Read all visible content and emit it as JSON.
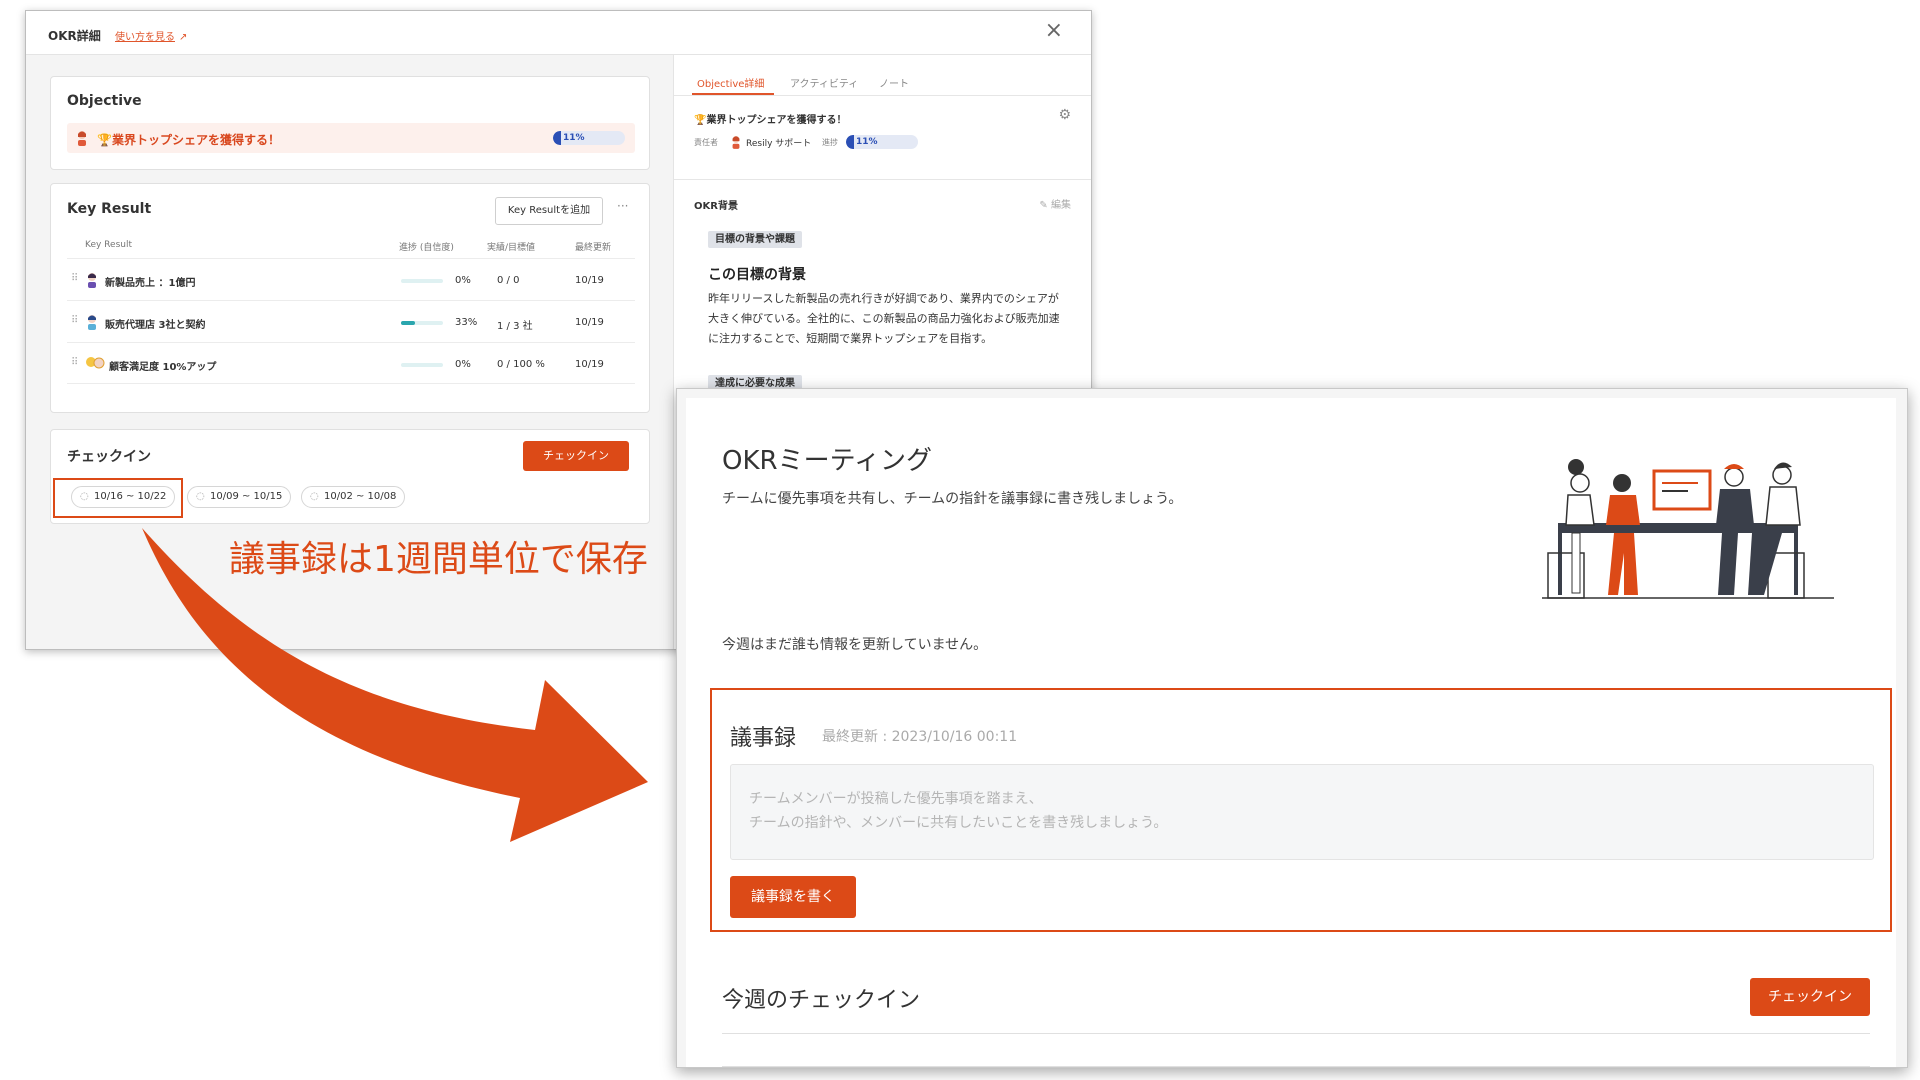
{
  "okr": {
    "title": "OKR詳細",
    "howto_link": "使い方を見る",
    "objective": {
      "heading": "Objective",
      "text": "🏆業界トップシェアを獲得する！",
      "progress": 11,
      "progress_label": "11%"
    },
    "key_result": {
      "heading": "Key Result",
      "add_button": "Key Resultを追加",
      "more": "···",
      "columns": [
        "Key Result",
        "進捗 (自信度)",
        "実績/目標値",
        "最終更新"
      ],
      "rows": [
        {
          "name": "新製品売上 ：1億円",
          "progress": 0,
          "pct": "0%",
          "actual": "0 / 0",
          "updated": "10/19"
        },
        {
          "name": "販売代理店 3社と契約",
          "progress": 33,
          "pct": "33%",
          "actual": "1 / 3 社",
          "updated": "10/19"
        },
        {
          "name": "顧客満足度 10%アップ",
          "progress": 0,
          "pct": "0%",
          "actual": "0 / 100 %",
          "updated": "10/19"
        }
      ]
    },
    "checkin": {
      "heading": "チェックイン",
      "button": "チェックイン",
      "weeks": [
        "10/16 ~ 10/22",
        "10/09 ~ 10/15",
        "10/02 ~ 10/08"
      ]
    },
    "right_pane": {
      "tabs": [
        "Objective詳細",
        "アクティビティ",
        "ノート"
      ],
      "objective_title": "🏆業界トップシェアを獲得する！",
      "owner_label": "責任者",
      "owner_name": "Resily サポート",
      "progress_label": "進捗",
      "progress": 11,
      "progress_text": "11%",
      "background_heading": "OKR背景",
      "edit_label": "編集",
      "tag1": "目標の背景や課題",
      "section_title": "この目標の背景",
      "section_body": "昨年リリースした新製品の売れ行きが好調であり、業界内でのシェアが大きく伸びている。全社的に、この新製品の商品力強化および販売加速に注力することで、短期間で業界トップシェアを目指す。",
      "tag2": "達成に必要な成果"
    }
  },
  "meeting": {
    "title": "OKRミーティング",
    "subtitle": "チームに優先事項を共有し、チームの指針を議事録に書き残しましょう。",
    "no_update": "今週はまだ誰も情報を更新していません。",
    "minutes": {
      "heading": "議事録",
      "last_updated": "最終更新 : 2023/10/16 00:11",
      "placeholder": "チームメンバーが投稿した優先事項を踏まえ、\nチームの指針や、メンバーに共有したいことを書き残しましょう。",
      "button": "議事録を書く"
    },
    "week_checkin": {
      "heading": "今週のチェックイン",
      "button": "チェックイン"
    }
  },
  "annotation": {
    "text": "議事録は1週間単位で保存"
  },
  "colors": {
    "accent": "#dc4a17",
    "progress_blue": "#2b4fb5",
    "kr_teal": "#2aa6ae"
  }
}
